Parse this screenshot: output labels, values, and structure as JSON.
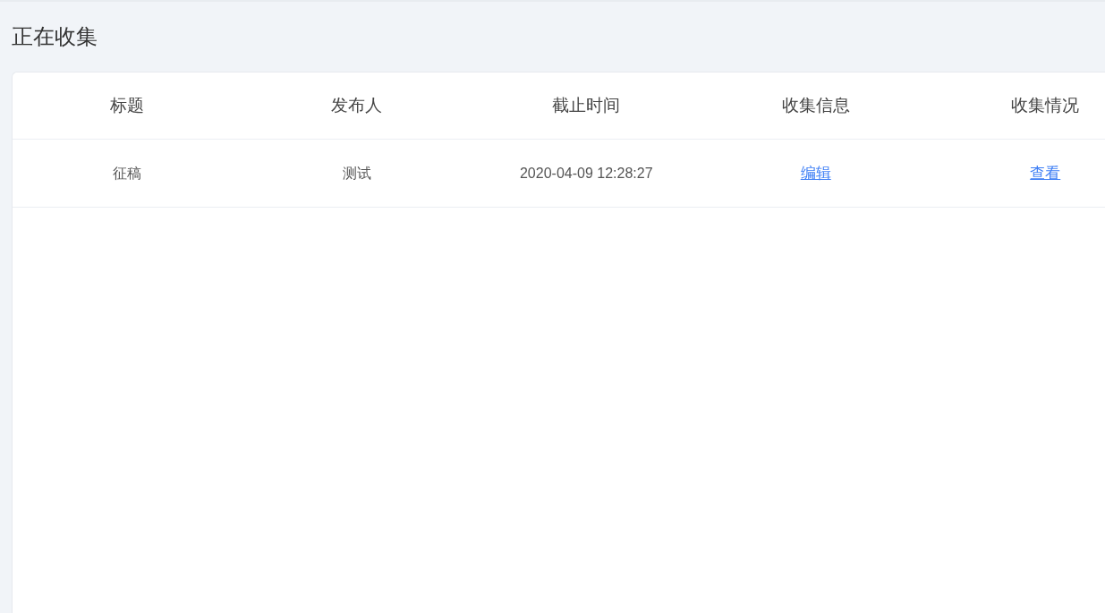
{
  "heading": "正在收集",
  "table": {
    "columns": [
      "标题",
      "发布人",
      "截止时间",
      "收集信息",
      "收集情况"
    ],
    "rows": [
      {
        "cells": [
          {
            "kind": "text",
            "text": "征稿"
          },
          {
            "kind": "text",
            "text": "测试"
          },
          {
            "kind": "text",
            "text": "2020-04-09 12:28:27"
          },
          {
            "kind": "link",
            "text": "编辑"
          },
          {
            "kind": "link",
            "text": "查看"
          }
        ]
      }
    ]
  }
}
